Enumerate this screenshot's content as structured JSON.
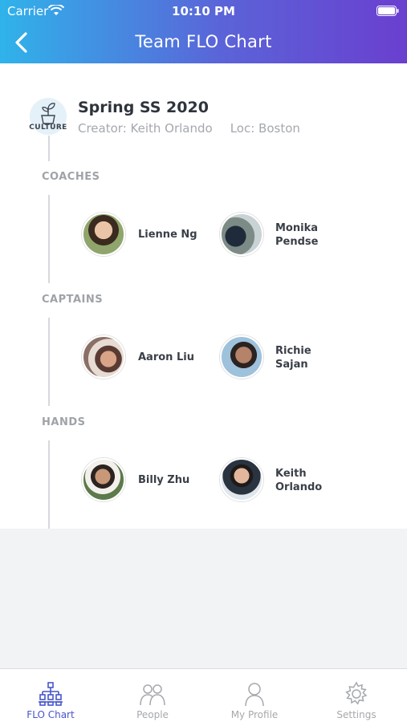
{
  "status_bar": {
    "carrier": "Carrier",
    "time": "10:10 PM"
  },
  "nav": {
    "title": "Team FLO Chart"
  },
  "team": {
    "logo_label": "CULTURE",
    "name": "Spring SS 2020",
    "creator": "Creator: Keith Orlando",
    "location": "Loc: Boston"
  },
  "sections": {
    "coaches": {
      "label": "COACHES",
      "people": [
        {
          "name": "Lienne Ng"
        },
        {
          "name": "Monika Pendse"
        }
      ]
    },
    "captains": {
      "label": "CAPTAINS",
      "people": [
        {
          "name": "Aaron Liu"
        },
        {
          "name": "Richie Sajan"
        }
      ]
    },
    "hands": {
      "label": "HANDS",
      "people": [
        {
          "name": "Billy Zhu"
        },
        {
          "name": "Keith Orlando"
        }
      ]
    }
  },
  "tabs": [
    {
      "label": "FLO Chart",
      "icon": "org-chart-icon",
      "active": true
    },
    {
      "label": "People",
      "icon": "people-icon",
      "active": false
    },
    {
      "label": "My Profile",
      "icon": "profile-icon",
      "active": false
    },
    {
      "label": "Settings",
      "icon": "gear-icon",
      "active": false
    }
  ],
  "colors": {
    "accent": "#4656c9",
    "header_start": "#2fb3ea",
    "header_end": "#6a3fcf"
  }
}
